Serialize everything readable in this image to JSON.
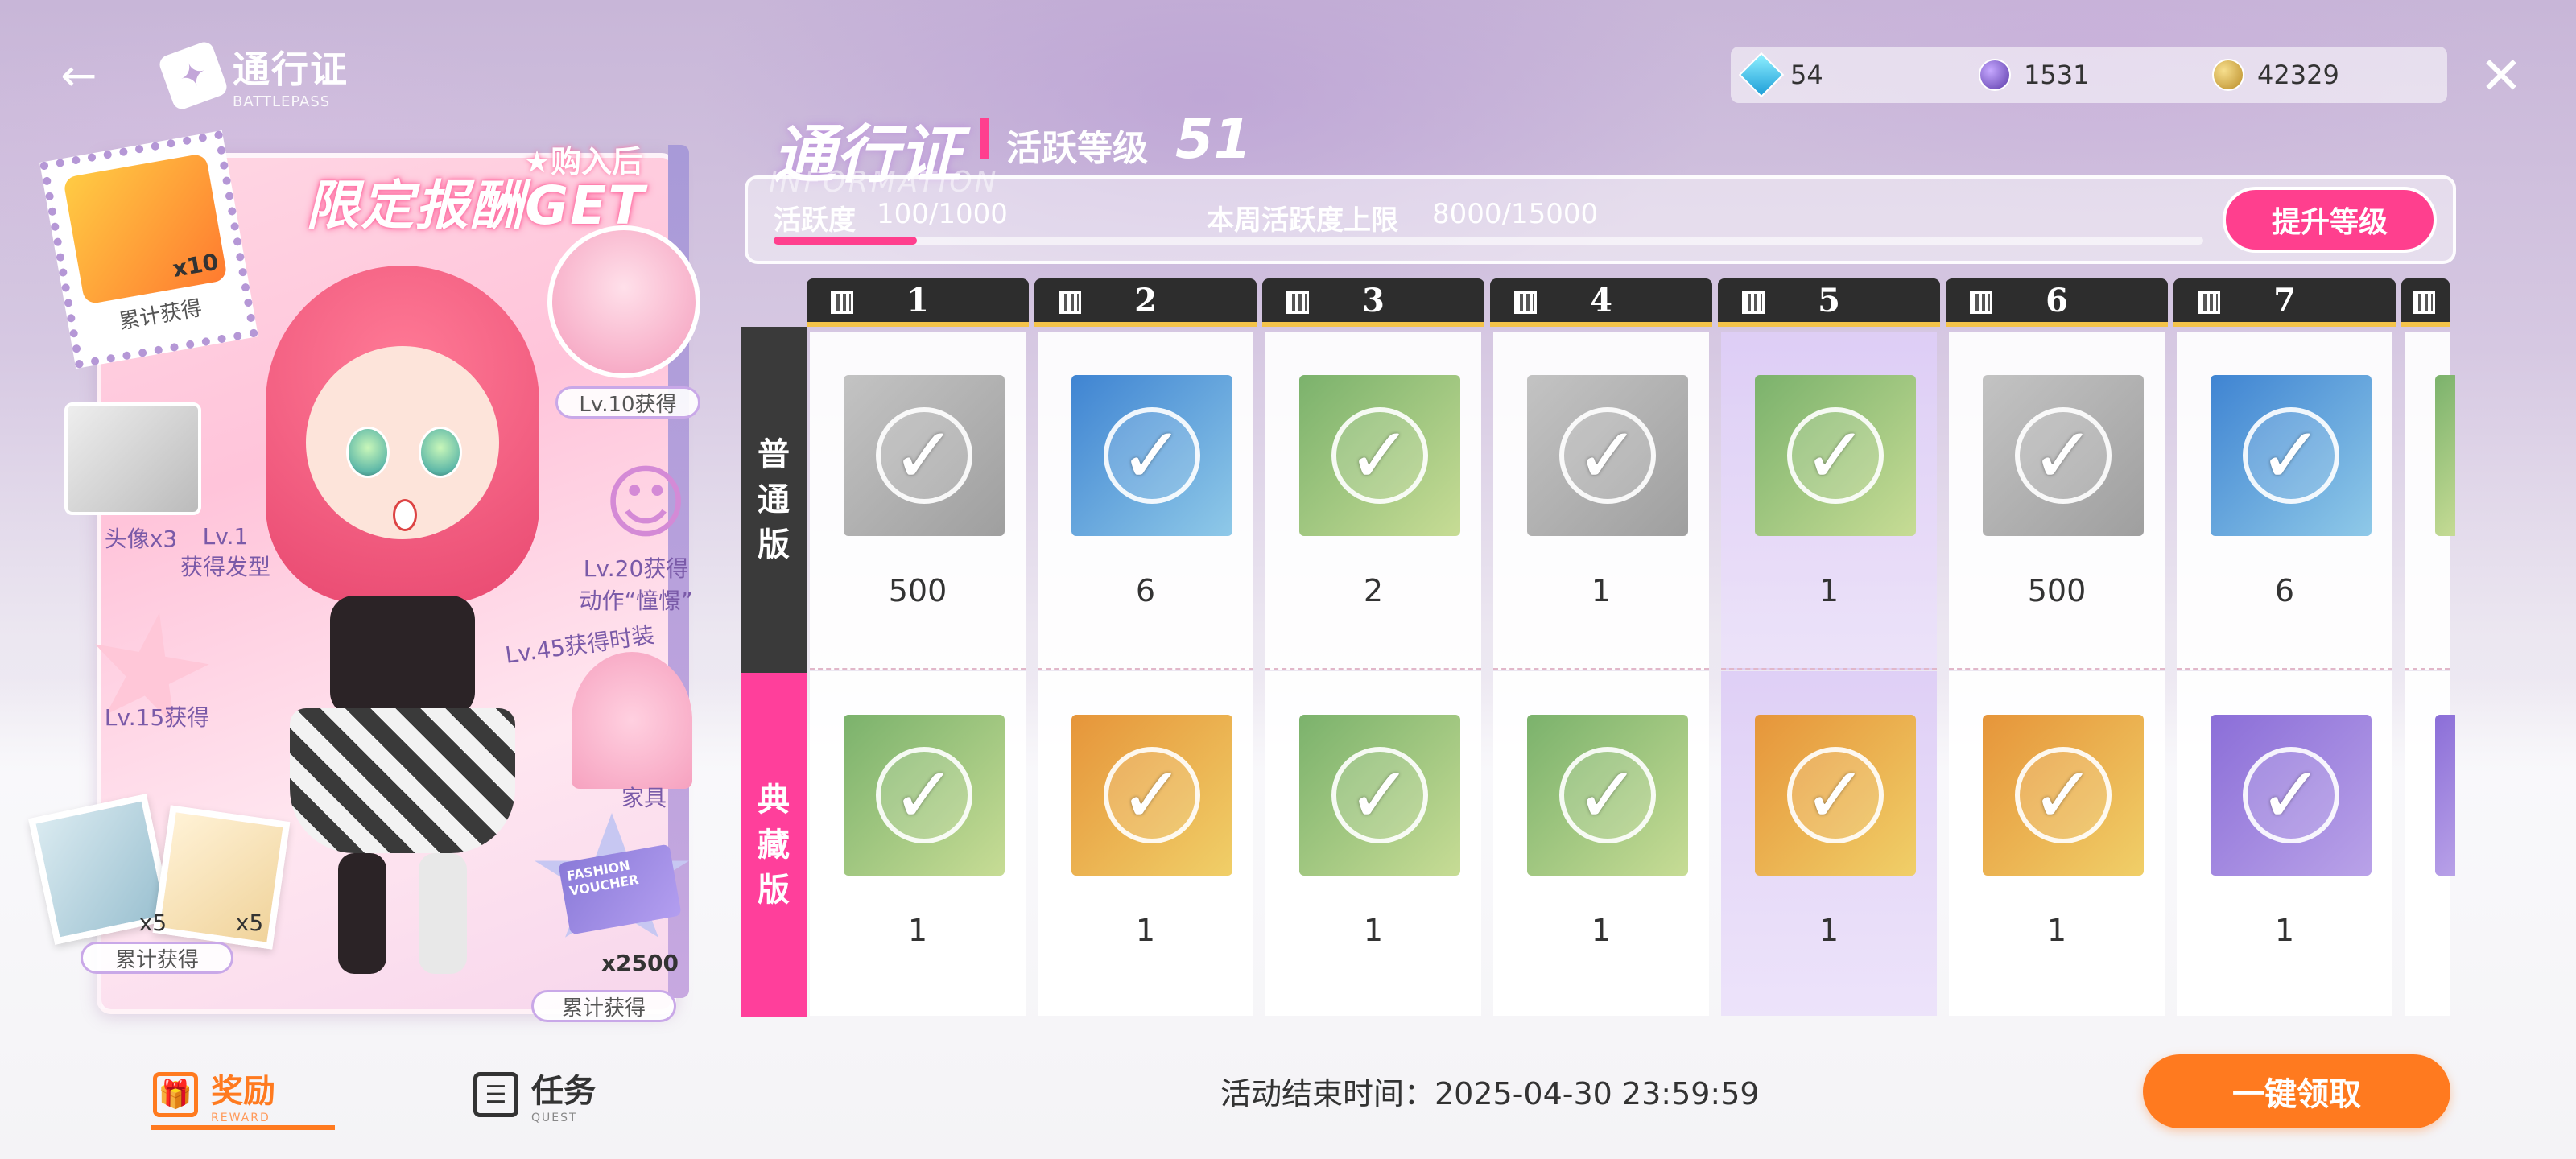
{
  "header": {
    "logo_title": "通行证",
    "logo_subtitle": "BATTLEPASS",
    "currencies": [
      {
        "icon": "diamond-icon",
        "value": "54"
      },
      {
        "icon": "star-orb-icon",
        "value": "1531"
      },
      {
        "icon": "coin-icon",
        "value": "42329"
      }
    ]
  },
  "promo": {
    "buy_after": "★购入后",
    "limited_reward": "限定报酬GET",
    "stamp_qty": "x10",
    "stamp_label": "累计获得",
    "lv10": "Lv.10获得",
    "avatar_qty": "头像x3",
    "lv1_line1": "Lv.1",
    "lv1_line2": "获得发型",
    "lv20_line1": "Lv.20获得",
    "lv20_line2": "动作“憧憬”",
    "lv45": "Lv.45获得时装",
    "lv15": "Lv.15获得",
    "furniture": "家具",
    "photo_qty_a": "x5",
    "photo_qty_b": "x5",
    "photos_label": "累计获得",
    "voucher_text": "FASHION VOUCHER",
    "voucher_qty": "x2500",
    "voucher_label": "累计获得"
  },
  "pass": {
    "title": "通行证",
    "level_label": "活跃等级",
    "level": "51",
    "info_watermark": "INFORMATION",
    "activity_label": "活跃度",
    "activity_value": "100/1000",
    "activity_progress": 0.1,
    "weekly_label": "本周活跃度上限",
    "weekly_value": "8000/15000",
    "upgrade_button": "提升等级"
  },
  "rows": {
    "normal": [
      "普",
      "通",
      "版"
    ],
    "collector": [
      "典",
      "藏",
      "版"
    ]
  },
  "columns": [
    {
      "num": "1",
      "normal": {
        "qty": "500",
        "color": "grey"
      },
      "collector": {
        "qty": "1",
        "color": "green"
      }
    },
    {
      "num": "2",
      "normal": {
        "qty": "6",
        "color": "blue"
      },
      "collector": {
        "qty": "1",
        "color": "orange"
      }
    },
    {
      "num": "3",
      "normal": {
        "qty": "2",
        "color": "green"
      },
      "collector": {
        "qty": "1",
        "color": "green"
      }
    },
    {
      "num": "4",
      "normal": {
        "qty": "1",
        "color": "grey"
      },
      "collector": {
        "qty": "1",
        "color": "green"
      }
    },
    {
      "num": "5",
      "normal": {
        "qty": "1",
        "color": "green"
      },
      "collector": {
        "qty": "1",
        "color": "orange"
      },
      "active": true
    },
    {
      "num": "6",
      "normal": {
        "qty": "500",
        "color": "grey"
      },
      "collector": {
        "qty": "1",
        "color": "orange"
      }
    },
    {
      "num": "7",
      "normal": {
        "qty": "6",
        "color": "blue"
      },
      "collector": {
        "qty": "1",
        "color": "purple"
      }
    }
  ],
  "footer": {
    "tab_reward": "奖励",
    "tab_reward_sub": "REWARD",
    "tab_quest": "任务",
    "tab_quest_sub": "QUEST",
    "end_time": "活动结束时间：2025-04-30 23:59:59",
    "claim_all": "一键领取"
  }
}
